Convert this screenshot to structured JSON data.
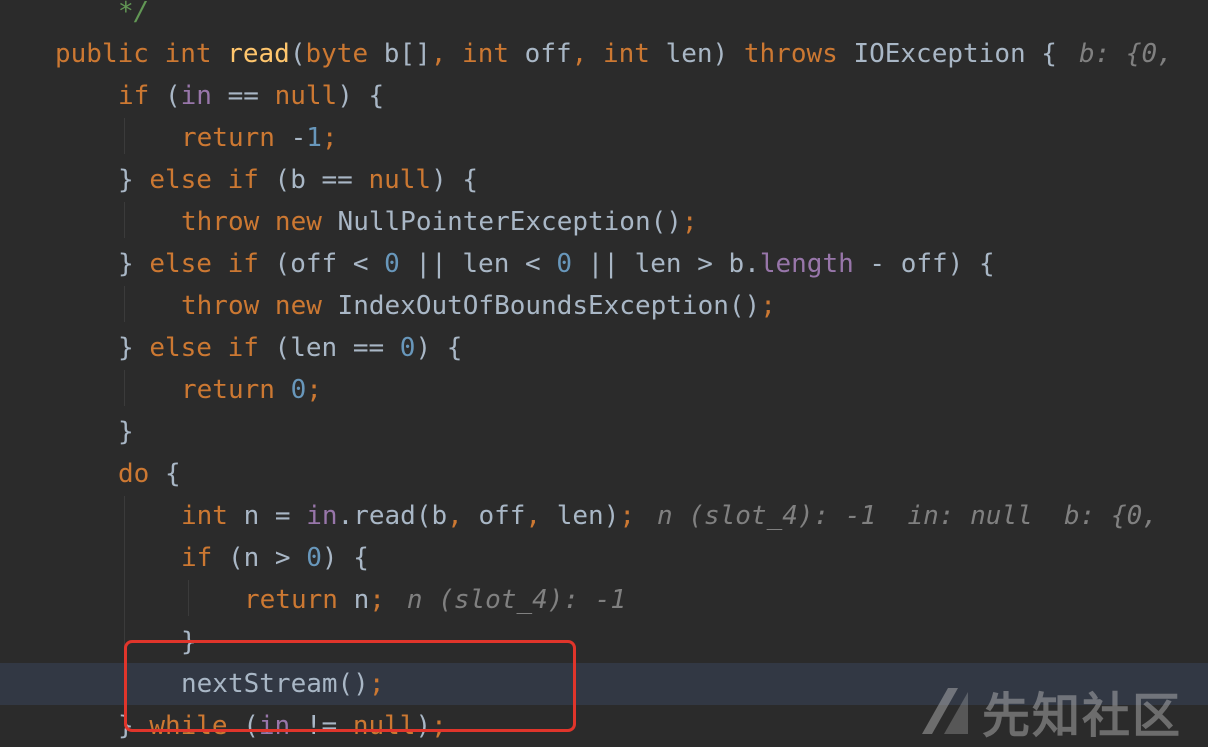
{
  "editor": {
    "lines": [
      {
        "indent": 2,
        "tokens": [
          {
            "t": "*/",
            "c": "doc"
          }
        ]
      },
      {
        "indent": 1,
        "tokens": [
          {
            "t": "public ",
            "c": "kw"
          },
          {
            "t": "int ",
            "c": "kw"
          },
          {
            "t": "read",
            "c": "fn"
          },
          {
            "t": "("
          },
          {
            "t": "byte ",
            "c": "kw"
          },
          {
            "t": "b[]"
          },
          {
            "t": ", ",
            "c": "kw"
          },
          {
            "t": "int ",
            "c": "kw"
          },
          {
            "t": "off"
          },
          {
            "t": ", ",
            "c": "kw"
          },
          {
            "t": "int ",
            "c": "kw"
          },
          {
            "t": "len) "
          },
          {
            "t": "throws ",
            "c": "kw"
          },
          {
            "t": "IOException {"
          },
          {
            "t": "b: {0, ",
            "c": "hint"
          }
        ]
      },
      {
        "indent": 2,
        "tokens": [
          {
            "t": "if ",
            "c": "kw"
          },
          {
            "t": "("
          },
          {
            "t": "in",
            "c": "field"
          },
          {
            "t": " == "
          },
          {
            "t": "null",
            "c": "kw"
          },
          {
            "t": ") {"
          }
        ]
      },
      {
        "indent": 3,
        "tokens": [
          {
            "t": "return ",
            "c": "kw"
          },
          {
            "t": "-"
          },
          {
            "t": "1",
            "c": "num"
          },
          {
            "t": ";",
            "c": "kw"
          }
        ]
      },
      {
        "indent": 2,
        "tokens": [
          {
            "t": "} "
          },
          {
            "t": "else if ",
            "c": "kw"
          },
          {
            "t": "(b == "
          },
          {
            "t": "null",
            "c": "kw"
          },
          {
            "t": ") {"
          }
        ]
      },
      {
        "indent": 3,
        "tokens": [
          {
            "t": "throw ",
            "c": "kw"
          },
          {
            "t": "new ",
            "c": "kw"
          },
          {
            "t": "NullPointerException()"
          },
          {
            "t": ";",
            "c": "kw"
          }
        ]
      },
      {
        "indent": 2,
        "tokens": [
          {
            "t": "} "
          },
          {
            "t": "else if ",
            "c": "kw"
          },
          {
            "t": "(off < "
          },
          {
            "t": "0",
            "c": "num"
          },
          {
            "t": " || len < "
          },
          {
            "t": "0",
            "c": "num"
          },
          {
            "t": " || len > b."
          },
          {
            "t": "length",
            "c": "field"
          },
          {
            "t": " - off) {"
          }
        ]
      },
      {
        "indent": 3,
        "tokens": [
          {
            "t": "throw ",
            "c": "kw"
          },
          {
            "t": "new ",
            "c": "kw"
          },
          {
            "t": "IndexOutOfBoundsException()"
          },
          {
            "t": ";",
            "c": "kw"
          }
        ]
      },
      {
        "indent": 2,
        "tokens": [
          {
            "t": "} "
          },
          {
            "t": "else if ",
            "c": "kw"
          },
          {
            "t": "(len == "
          },
          {
            "t": "0",
            "c": "num"
          },
          {
            "t": ") {"
          }
        ]
      },
      {
        "indent": 3,
        "tokens": [
          {
            "t": "return ",
            "c": "kw"
          },
          {
            "t": "0",
            "c": "num"
          },
          {
            "t": ";",
            "c": "kw"
          }
        ]
      },
      {
        "indent": 2,
        "tokens": [
          {
            "t": "}"
          }
        ]
      },
      {
        "indent": 2,
        "tokens": [
          {
            "t": "do ",
            "c": "kw"
          },
          {
            "t": "{"
          }
        ]
      },
      {
        "indent": 3,
        "tokens": [
          {
            "t": "int ",
            "c": "kw"
          },
          {
            "t": "n = "
          },
          {
            "t": "in",
            "c": "field"
          },
          {
            "t": ".read(b"
          },
          {
            "t": ", ",
            "c": "kw"
          },
          {
            "t": "off"
          },
          {
            "t": ", ",
            "c": "kw"
          },
          {
            "t": "len)"
          },
          {
            "t": ";",
            "c": "kw"
          },
          {
            "t": "n (slot_4): -1  in: null  b: {0, ",
            "c": "hint"
          }
        ]
      },
      {
        "indent": 3,
        "tokens": [
          {
            "t": "if ",
            "c": "kw"
          },
          {
            "t": "(n > "
          },
          {
            "t": "0",
            "c": "num"
          },
          {
            "t": ") {"
          }
        ]
      },
      {
        "indent": 4,
        "tokens": [
          {
            "t": "return ",
            "c": "kw"
          },
          {
            "t": "n"
          },
          {
            "t": ";",
            "c": "kw"
          },
          {
            "t": "n (slot_4): -1",
            "c": "hint"
          }
        ]
      },
      {
        "indent": 3,
        "tokens": [
          {
            "t": "}"
          }
        ]
      },
      {
        "indent": 3,
        "current": true,
        "tokens": [
          {
            "t": "nextStream()"
          },
          {
            "t": ";",
            "c": "kw"
          }
        ]
      },
      {
        "indent": 2,
        "tokens": [
          {
            "t": "} "
          },
          {
            "t": "while ",
            "c": "kw"
          },
          {
            "t": "("
          },
          {
            "t": "in",
            "c": "field"
          },
          {
            "t": " != "
          },
          {
            "t": "null",
            "c": "kw"
          },
          {
            "t": ")"
          },
          {
            "t": ";",
            "c": "kw"
          }
        ]
      }
    ]
  },
  "watermark": {
    "text": "先知社区"
  }
}
